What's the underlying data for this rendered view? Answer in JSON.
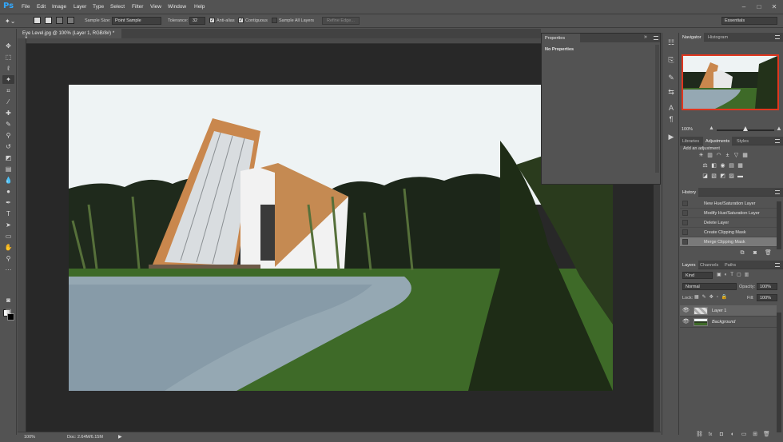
{
  "menubar": {
    "logo": "Ps",
    "items": [
      "File",
      "Edit",
      "Image",
      "Layer",
      "Type",
      "Select",
      "Filter",
      "View",
      "Window",
      "Help"
    ],
    "window_controls": [
      "–",
      "□",
      "✕"
    ]
  },
  "options": {
    "sample_size_label": "Sample Size:",
    "sample_size_value": "Point Sample",
    "tolerance_label": "Tolerance:",
    "tolerance_value": "32",
    "anti_alias_label": "Anti-alias",
    "contiguous_label": "Contiguous",
    "sample_all_layers_label": "Sample All Layers",
    "refine_edge_label": "Refine Edge...",
    "workspace": "Essentials"
  },
  "document": {
    "tab_title": "Eye Level.jpg @ 100% (Layer 1, RGB/8#) *",
    "close": "×"
  },
  "status": {
    "zoom": "100%",
    "doc": "Doc: 2.64M/6.15M"
  },
  "properties": {
    "tab": "Properties",
    "message": "No Properties"
  },
  "navigator": {
    "tabs": [
      "Navigator",
      "Histogram"
    ],
    "zoom": "100%",
    "zoom_level": 0.5
  },
  "adjustments": {
    "tabs": [
      "Libraries",
      "Adjustments",
      "Styles"
    ],
    "heading": "Add an adjustment",
    "icons": [
      "brightness-contrast-icon",
      "levels-icon",
      "curves-icon",
      "exposure-icon",
      "vibrance-icon",
      "hue-saturation-icon",
      "color-balance-icon",
      "black-white-icon",
      "photo-filter-icon",
      "channel-mixer-icon",
      "color-lookup-icon",
      "invert-icon",
      "posterize-icon",
      "threshold-icon",
      "selective-color-icon",
      "gradient-map-icon"
    ]
  },
  "history": {
    "tab": "History",
    "items": [
      "New Hue/Saturation Layer",
      "Modify Hue/Saturation Layer",
      "Delete Layer",
      "Create Clipping Mask",
      "Merge Clipping Mask"
    ],
    "selected_index": 4
  },
  "layers": {
    "tabs": [
      "Layers",
      "Channels",
      "Paths"
    ],
    "kind": "Kind",
    "blend_mode": "Normal",
    "opacity_label": "Opacity:",
    "opacity_value": "100%",
    "lock_label": "Lock:",
    "fill_label": "Fill:",
    "fill_value": "100%",
    "rows": [
      {
        "name": "Layer 1",
        "selected": true
      },
      {
        "name": "Background",
        "selected": false
      }
    ],
    "bottom_buttons": [
      "link-icon",
      "fx-icon",
      "mask-icon",
      "adjustment-layer-icon",
      "group-icon",
      "new-layer-icon",
      "trash-icon"
    ]
  },
  "colors": {
    "accent": "#31a8ff",
    "nav_frame": "#e0361f",
    "panel": "#535353",
    "canvas_bg": "#282828"
  }
}
